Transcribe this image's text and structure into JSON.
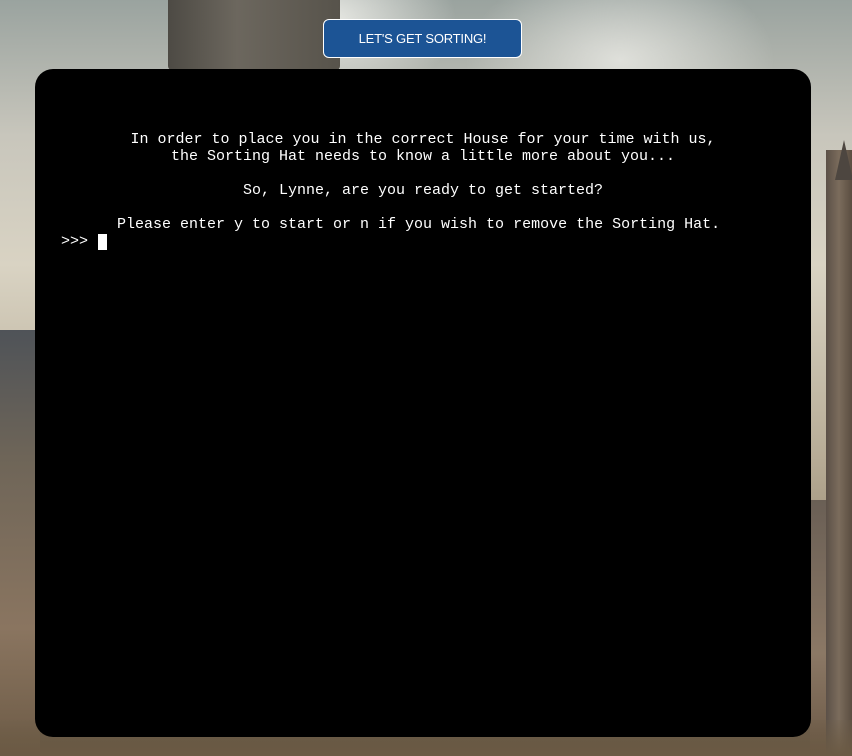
{
  "header": {
    "start_button_label": "LET'S GET SORTING!"
  },
  "terminal": {
    "intro_line_1": "In order to place you in the correct House for your time with us,",
    "intro_line_2": "the Sorting Hat needs to know a little more about you...",
    "question": "So, Lynne, are you ready to get started?",
    "instruction": "Please enter y to start or n if you wish to remove the Sorting Hat.",
    "prompt": ">>>"
  },
  "colors": {
    "button_bg": "#1c5495",
    "terminal_bg": "#000000",
    "terminal_text": "#ffffff"
  }
}
